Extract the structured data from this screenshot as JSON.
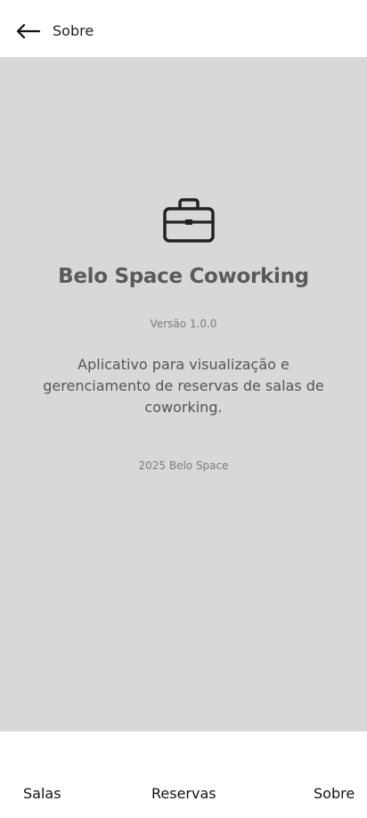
{
  "header": {
    "title": "Sobre",
    "back_icon": "arrow-left-icon"
  },
  "about": {
    "icon": "briefcase-icon",
    "app_name": "Belo Space Coworking",
    "version": "Versão 1.0.0",
    "description": "Aplicativo para visualização e gerenciamento de reservas de salas de coworking.",
    "copyright": "2025 Belo Space"
  },
  "colors": {
    "content_background": "#d8d8d8",
    "title_text": "#5a5a5a",
    "secondary_text": "#7d7d7d"
  },
  "bottom_nav": {
    "items": [
      {
        "label": "Salas"
      },
      {
        "label": "Reservas"
      },
      {
        "label": "Sobre"
      }
    ]
  }
}
